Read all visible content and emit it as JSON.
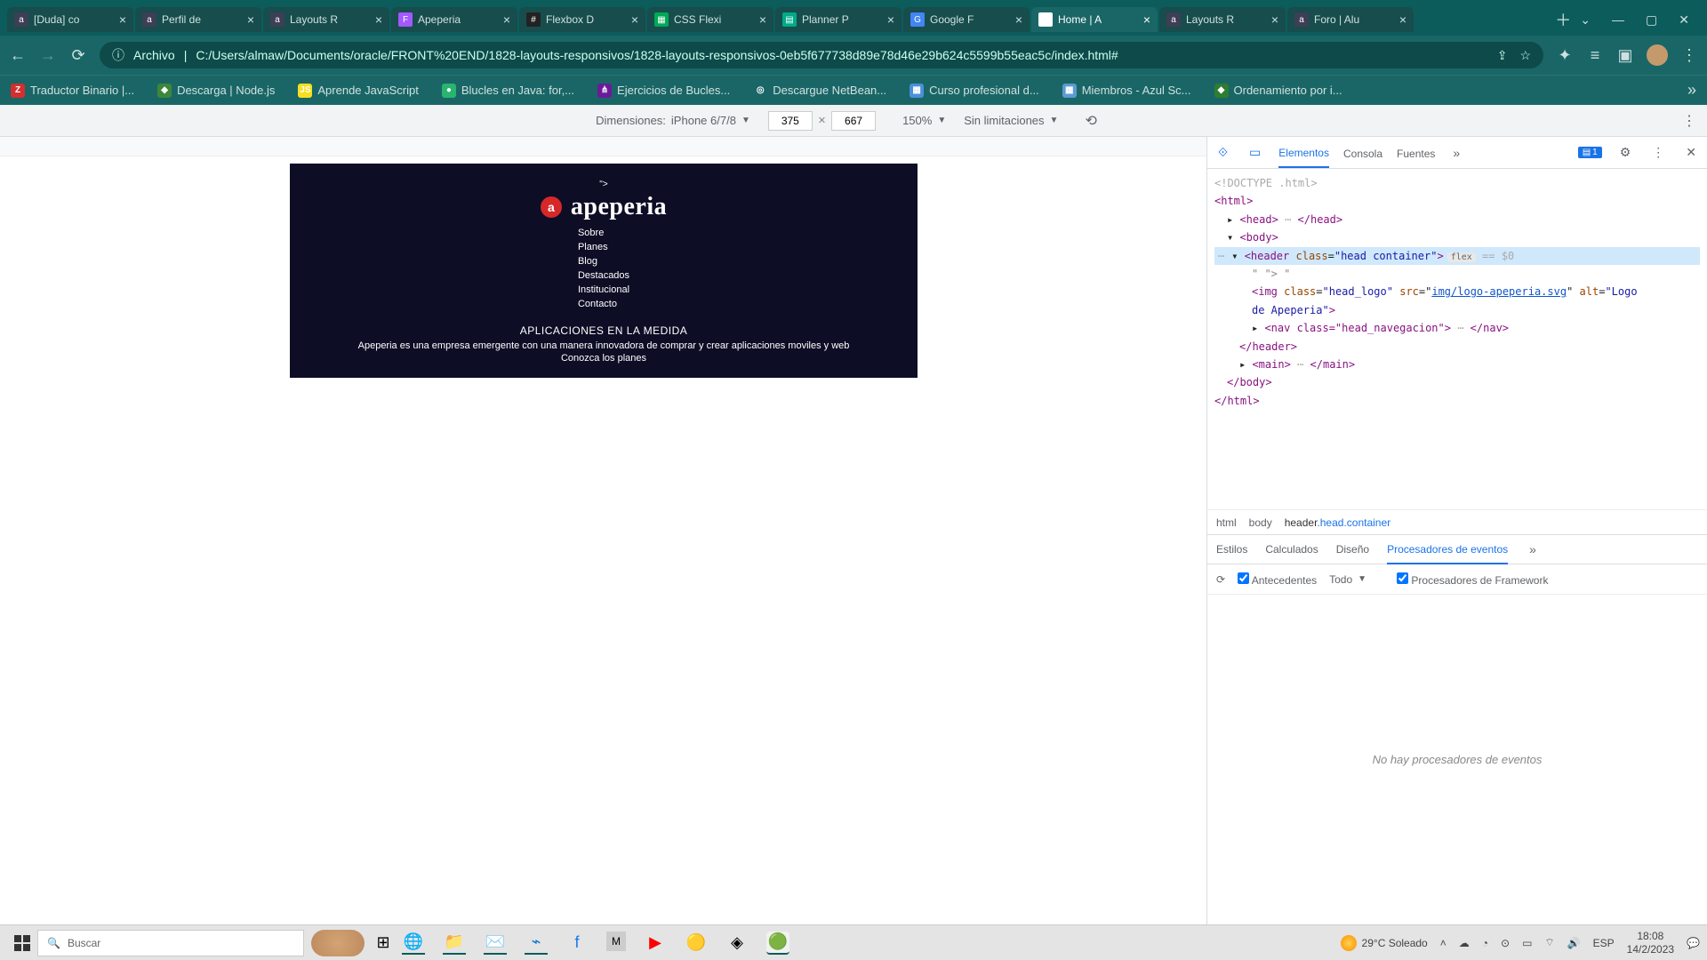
{
  "tabs": [
    {
      "title": "[Duda] co",
      "fav": "#3e3e56",
      "letter": "a"
    },
    {
      "title": "Perfil de",
      "fav": "#3e3e56",
      "letter": "a"
    },
    {
      "title": "Layouts R",
      "fav": "#3e3e56",
      "letter": "a"
    },
    {
      "title": "Apeperia",
      "fav": "#a259ff",
      "letter": "F"
    },
    {
      "title": "Flexbox D",
      "fav": "#222",
      "letter": "#"
    },
    {
      "title": "CSS Flexi",
      "fav": "#0a5",
      "letter": "▦"
    },
    {
      "title": "Planner P",
      "fav": "#0a8",
      "letter": "▤"
    },
    {
      "title": "Google F",
      "fav": "#4285f4",
      "letter": "G"
    },
    {
      "title": "Home | A",
      "fav": "#fff",
      "letter": "◷",
      "active": true
    },
    {
      "title": "Layouts R",
      "fav": "#3e3e56",
      "letter": "a"
    },
    {
      "title": "Foro | Alu",
      "fav": "#3e3e56",
      "letter": "a"
    }
  ],
  "url": {
    "proto": "Archivo",
    "path": "C:/Users/almaw/Documents/oracle/FRONT%20END/1828-layouts-responsivos/1828-layouts-responsivos-0eb5f677738d89e78d46e29b624c5599b55eac5c/index.html#"
  },
  "bookmarks": [
    {
      "label": "Traductor Binario |...",
      "bg": "#d32f2f",
      "gly": "Z"
    },
    {
      "label": "Descarga | Node.js",
      "bg": "#3c873a",
      "gly": "◆"
    },
    {
      "label": "Aprende JavaScript",
      "bg": "#f7df1e",
      "gly": "JS"
    },
    {
      "label": "Blucles en Java: for,...",
      "bg": "#27b56f",
      "gly": "●"
    },
    {
      "label": "Ejercicios de Bucles...",
      "bg": "#6a1b9a",
      "gly": "⋔"
    },
    {
      "label": "Descargue NetBean...",
      "bg": "#1a6666",
      "gly": "◎"
    },
    {
      "label": "Curso profesional d...",
      "bg": "#4a90d9",
      "gly": "▦"
    },
    {
      "label": "Miembros - Azul Sc...",
      "bg": "#5c9bd1",
      "gly": "▦"
    },
    {
      "label": "Ordenamiento por i...",
      "bg": "#2e7d32",
      "gly": "◆"
    }
  ],
  "deviceBar": {
    "label_dim": "Dimensiones:",
    "device": "iPhone 6/7/8",
    "w": "375",
    "h": "667",
    "zoom": "150%",
    "throttle": "Sin limitaciones"
  },
  "apeperia": {
    "brand": "apeperia",
    "nav": [
      "Sobre",
      "Planes",
      "Blog",
      "Destacados",
      "Institucional",
      "Contacto"
    ],
    "heading": "APLICACIONES EN LA MEDIDA",
    "desc": "Apeperia es una empresa emergente con una manera innovadora de comprar y crear aplicaciones moviles y web",
    "cta": "Conozca los planes"
  },
  "devtools": {
    "tabs": {
      "elements": "Elementos",
      "console": "Consola",
      "sources": "Fuentes"
    },
    "issue_count": "1",
    "dom": {
      "doctype": "<!DOCTYPE .html>",
      "html_open": "<html>",
      "head": "<head>",
      "head_close": "</head>",
      "body_open": "<body>",
      "header_open": "<header class=\"head container\">",
      "flex_badge": "flex",
      "eq": "== $0",
      "whitespace": "\" \"> \"",
      "img": "<img class=\"head_logo\" src=\"",
      "img_src": "img/logo-apeperia.svg",
      "img_tail": "\" alt=\"Logo de Apeperia\">",
      "nav": "<nav class=\"head_navegacion\">",
      "nav_close": "</nav>",
      "header_close": "</header>",
      "main": "<main>",
      "main_close": "</main>",
      "body_close": "</body>",
      "html_close": "</html>"
    },
    "crumbs": {
      "html": "html",
      "body": "body",
      "header": "header",
      "headerclass": ".head.container"
    },
    "subtabs": {
      "styles": "Estilos",
      "computed": "Calculados",
      "layout": "Diseño",
      "events": "Procesadores de eventos"
    },
    "eventbar": {
      "ancestors": "Antecedentes",
      "all": "Todo",
      "framework": "Procesadores de Framework"
    },
    "noevents": "No hay procesadores de eventos"
  },
  "taskbar": {
    "search_ph": "Buscar",
    "weather": "29°C  Soleado",
    "lang": "ESP",
    "time": "18:08",
    "date": "14/2/2023"
  }
}
